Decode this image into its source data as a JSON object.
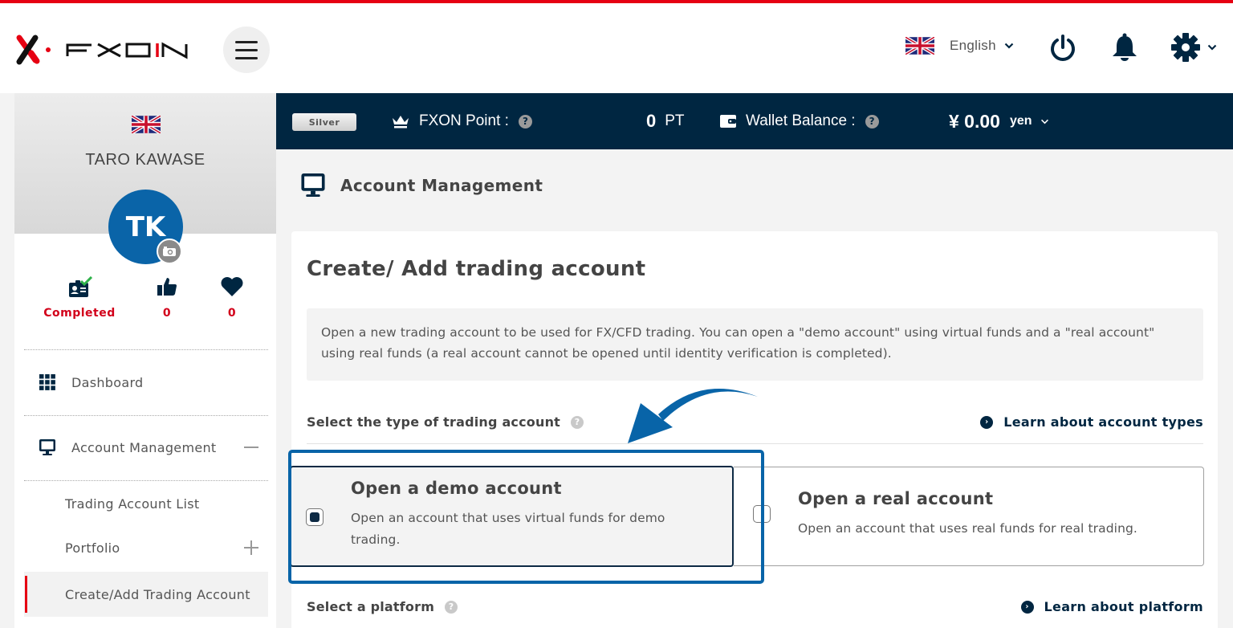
{
  "header": {
    "brand": "FXON",
    "language": "English",
    "icons": [
      "menu-icon",
      "uk-flag-icon",
      "chevron-down-icon",
      "power-icon",
      "bell-icon",
      "gear-icon"
    ]
  },
  "sidebar": {
    "user_name": "TARO KAWASE",
    "avatar_initials": "TK",
    "stats": [
      {
        "icon": "id-card-check-icon",
        "value": "Completed"
      },
      {
        "icon": "thumbs-up-icon",
        "value": "0"
      },
      {
        "icon": "heart-icon",
        "value": "0"
      }
    ],
    "nav": [
      {
        "label": "Dashboard",
        "icon": "grid-icon"
      },
      {
        "label": "Account Management",
        "icon": "monitor-icon",
        "toggle": "−"
      }
    ],
    "sub_items": [
      {
        "label": "Trading Account List"
      },
      {
        "label": "Portfolio",
        "toggle": "+"
      },
      {
        "label": "Create/Add Trading Account",
        "active": true
      }
    ]
  },
  "infobar": {
    "tier": "Silver",
    "points_label": "FXON Point :",
    "points_value": "0",
    "points_unit": "PT",
    "wallet_label": "Wallet Balance :",
    "wallet_value": "¥ 0.00",
    "wallet_unit": "yen",
    "help": "?"
  },
  "main": {
    "page_title": "Account Management",
    "card_title": "Create/ Add trading account",
    "description": "Open a new trading account to be used for FX/CFD trading. You can open a \"demo account\" using virtual funds and a \"real account\" using real funds (a real account cannot be opened until identity verification is completed).",
    "account_type_label": "Select the type of trading account",
    "account_type_link": "Learn about account types",
    "options": [
      {
        "title": "Open a demo account",
        "desc": "Open an account that uses virtual funds for demo trading.",
        "selected": true
      },
      {
        "title": "Open a real account",
        "desc": "Open an account that uses real funds for real trading.",
        "selected": false
      }
    ],
    "platform_label": "Select a platform",
    "platform_link": "Learn about platform"
  },
  "colors": {
    "brand_red": "#e60012",
    "navy": "#002641",
    "highlight_blue": "#0864a8",
    "avatar_blue": "#0a64a8",
    "status_red": "#d2001a"
  }
}
